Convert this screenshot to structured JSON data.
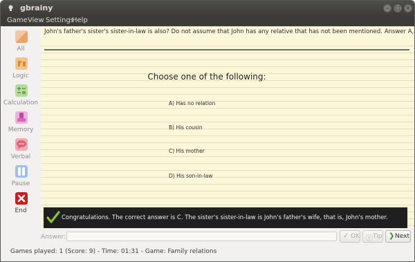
{
  "window": {
    "title": "gbrainy"
  },
  "menu": [
    "Game",
    "View",
    "Settings",
    "Help"
  ],
  "sidebar": {
    "items": [
      {
        "label": "All",
        "icon": "all-games-icon",
        "color": "#e8a56b"
      },
      {
        "label": "Logic",
        "icon": "logic-puzzle-icon",
        "color": "#e8a040"
      },
      {
        "label": "Calculation",
        "icon": "calculation-icon",
        "color": "#8cc06e"
      },
      {
        "label": "Memory",
        "icon": "memory-icon",
        "color": "#d868b8"
      },
      {
        "label": "Verbal",
        "icon": "verbal-icon",
        "color": "#e0607a"
      },
      {
        "label": "Pause",
        "icon": "pause-icon",
        "color": "#4a7ec8"
      },
      {
        "label": "End",
        "icon": "end-icon",
        "color": "#c81e1e"
      }
    ]
  },
  "question": "John's father's sister's sister-in-law is also? Do not assume that John has any relative that has not been mentioned. Answer A, B, C or D.",
  "choices": {
    "title": "Choose one of the following:",
    "options": [
      "A) Has no relation",
      "B) His cousin",
      "C) His mother",
      "D) His son-in-law"
    ]
  },
  "result": "Congratulations. The correct answer is C. The sister's sister-in-law is John's father's wife, that is, John's mother.",
  "answer": {
    "label": "Answer:",
    "value": ""
  },
  "buttons": {
    "ok": "OK",
    "tip": "Tip",
    "next": "Next"
  },
  "status": "Games played: 1 (Score: 9) - Time: 01:31 - Game: Family relations"
}
